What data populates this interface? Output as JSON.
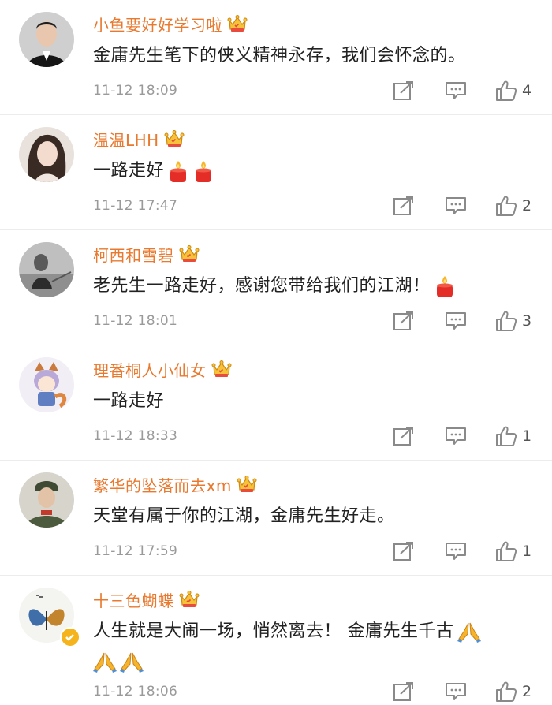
{
  "comments": [
    {
      "username": "小鱼要好好学习啦",
      "text": "金庸先生笔下的侠义精神永存，我们会怀念的。",
      "time": "11-12 18:09",
      "likes": "4"
    },
    {
      "username": "温温LHH",
      "text": "一路走好",
      "time": "11-12 17:47",
      "likes": "2"
    },
    {
      "username": "柯西和雪碧",
      "text": "老先生一路走好，感谢您带给我们的江湖！",
      "time": "11-12 18:01",
      "likes": "3"
    },
    {
      "username": "理番桐人小仙女",
      "text": "一路走好",
      "time": "11-12 18:33",
      "likes": "1"
    },
    {
      "username": "繁华的坠落而去xm",
      "text": "天堂有属于你的江湖，金庸先生好走。",
      "time": "11-12 17:59",
      "likes": "1"
    },
    {
      "username": "十三色蝴蝶",
      "text": "人生就是大闹一场，悄然离去！ 金庸先生千古",
      "time": "11-12 18:06",
      "likes": "2"
    }
  ],
  "colors": {
    "username": "#e8792f",
    "text": "#222222",
    "meta": "#9a9a9a",
    "icon": "#8a8a8a"
  },
  "icons": [
    "share-icon",
    "reply-icon",
    "thumbs-up-icon",
    "crown-member-icon",
    "candle-emoji",
    "pray-emoji",
    "verified-badge-icon"
  ]
}
